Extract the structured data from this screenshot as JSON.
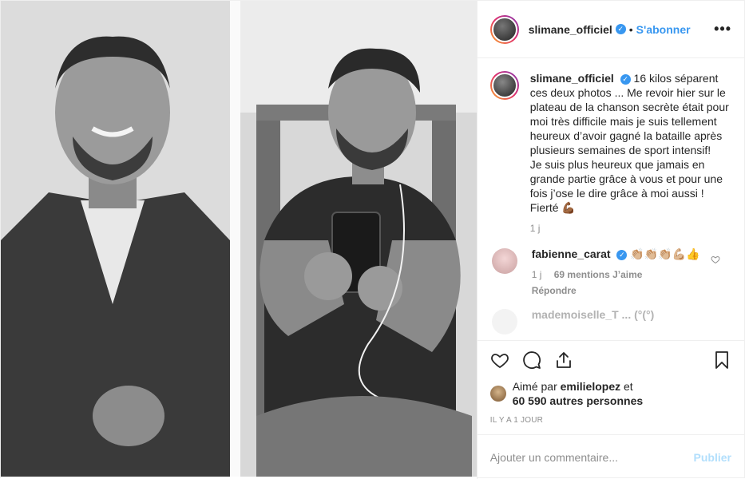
{
  "post": {
    "username": "slimane_officiel",
    "follow_label": "S'abonner",
    "separator": "•",
    "more_label": "•••",
    "verified_glyph": "✓"
  },
  "caption": {
    "username": "slimane_officiel",
    "text": "16 kilos séparent ces deux photos ... Me revoir hier sur le plateau de la chanson secrète était pour moi très difficile mais je suis tellement heureux d’avoir gagné la bataille après plusieurs semaines de sport intensif!\nJe suis plus heureux que jamais en grande partie grâce à vous et pour une fois j’ose le dire grâce à moi aussi ! Fierté 💪🏾",
    "time": "1 j"
  },
  "comments": [
    {
      "username": "fabienne_carat",
      "text": "👏🏼👏🏼👏🏼💪🏼👍",
      "time": "1 j",
      "likes": "69 mentions J’aime",
      "reply_label": "Répondre"
    }
  ],
  "partial_comment": "mademoiselle_T ... (°(°)",
  "likes": {
    "prefix": "Aimé par",
    "user": "emilielopez",
    "conj": "et",
    "others": "60 590 autres personnes"
  },
  "timestamp": "Il y a 1 jour",
  "add_comment": {
    "placeholder": "Ajouter un commentaire...",
    "publish_label": "Publier"
  },
  "icons": {
    "like": "heart-icon",
    "comment": "comment-icon",
    "share": "share-icon",
    "save": "bookmark-icon"
  },
  "colors": {
    "accent": "#3897f0",
    "publish_disabled": "#b2dffc",
    "muted": "#8e8e8e"
  }
}
